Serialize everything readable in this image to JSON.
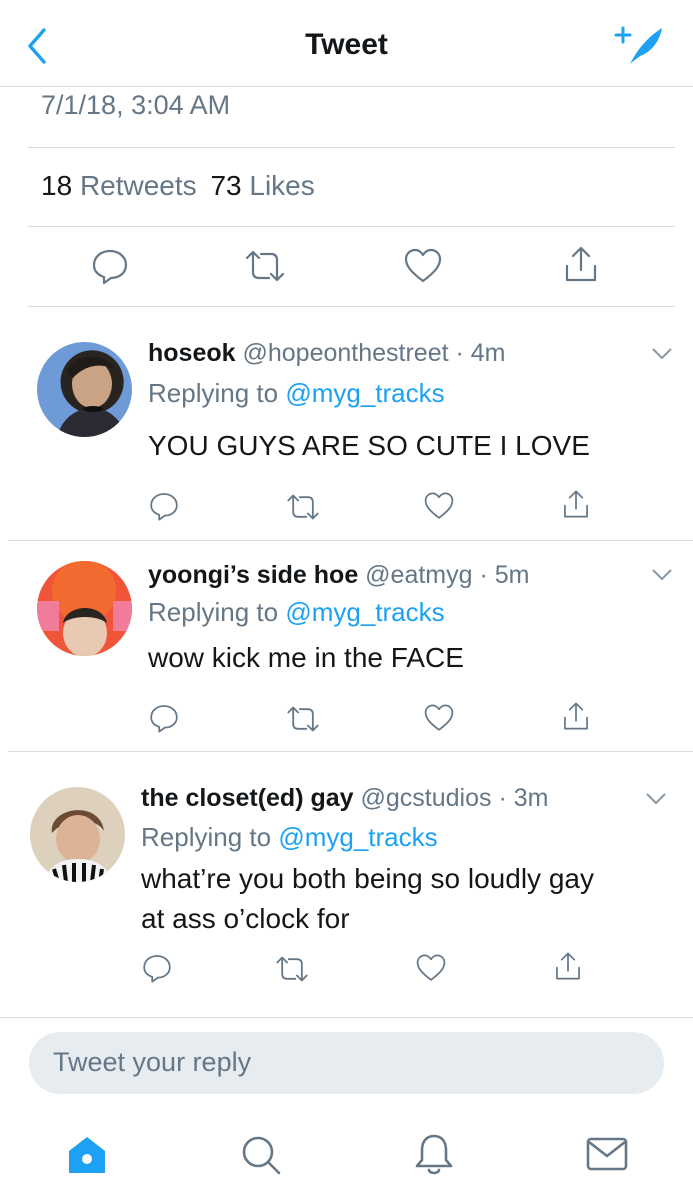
{
  "header": {
    "title": "Tweet",
    "back_icon": "chevron-left-icon",
    "compose_icon": "compose-feather-icon"
  },
  "tweet": {
    "timestamp": "7/1/18, 3:04 AM",
    "retweets": "18",
    "retweets_label": "Retweets",
    "likes": "73",
    "likes_label": "Likes"
  },
  "replies": [
    {
      "name": "hoseok",
      "handle": "@hopeonthestreet · 4m",
      "replying_prefix": "Replying to",
      "replying_to": "@myg_tracks",
      "text": "YOU GUYS ARE SO CUTE I LOVE"
    },
    {
      "name": "yoongi’s side hoe",
      "handle": "@eatmyg · 5m",
      "replying_prefix": "Replying to",
      "replying_to": "@myg_tracks",
      "text": "wow kick me in the FACE"
    },
    {
      "name": "the closet(ed) gay",
      "handle": "@gcstudios · 3m",
      "replying_prefix": "Replying to",
      "replying_to": "@myg_tracks",
      "text_line1": "what’re you both being so loudly gay",
      "text_line2": "at ass o’clock for"
    }
  ],
  "reply_box": {
    "placeholder": "Tweet your reply"
  },
  "tabbar": {
    "items": [
      "home-icon",
      "search-icon",
      "notifications-bell-icon",
      "messages-envelope-icon"
    ]
  },
  "colors": {
    "accent": "#1da1f2",
    "secondary_text": "#657786",
    "divider": "#d6dbe0",
    "input_bg": "#e6ecf0"
  }
}
